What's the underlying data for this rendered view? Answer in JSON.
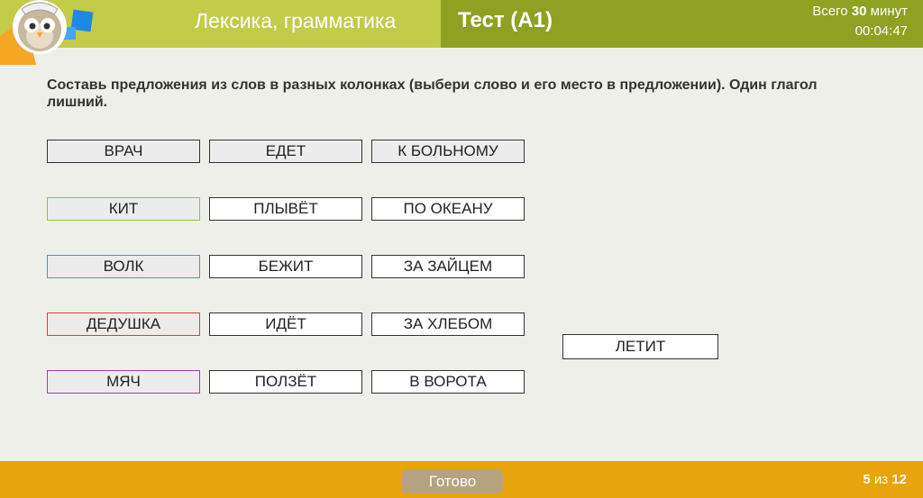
{
  "header": {
    "subject": "Лексика, грамматика",
    "test_title": "Тест (А1)",
    "timer_label_prefix": "Всего",
    "timer_minutes": "30",
    "timer_label_suffix": "минут",
    "timer_value": "00:04:47"
  },
  "instruction": "Составь предложения из слов в разных колонках (выбери слово и его место в предложении). Один глагол лишний.",
  "rows": [
    {
      "subject": "ВРАЧ",
      "verb": "ЕДЕТ",
      "object": "К БОЛЬНОМУ",
      "accent": "#333333"
    },
    {
      "subject": "КИТ",
      "verb": "ПЛЫВЁТ",
      "object": "ПО ОКЕАНУ",
      "accent": "#8bc34a"
    },
    {
      "subject": "ВОЛК",
      "verb": "БЕЖИТ",
      "object": "ЗА ЗАЙЦЕМ",
      "accent": "#4a90d9"
    },
    {
      "subject": "ДЕДУШКА",
      "verb": "ИДЁТ",
      "object": "ЗА ХЛЕБОМ",
      "accent": "#e53935"
    },
    {
      "subject": "МЯЧ",
      "verb": "ПОЛЗЁТ",
      "object": "В ВОРОТА",
      "accent": "#8e44ad"
    }
  ],
  "extra_verb": "ЛЕТИТ",
  "footer": {
    "done_label": "Готово",
    "page_current": "5",
    "page_sep": "из",
    "page_total": "12"
  },
  "colors": {
    "header_light": "#c2cc48",
    "header_dark": "#8ea122",
    "footer": "#e8a40c",
    "done_button": "#b6a381"
  },
  "icons": {
    "logo": "owl-mascot-icon"
  }
}
